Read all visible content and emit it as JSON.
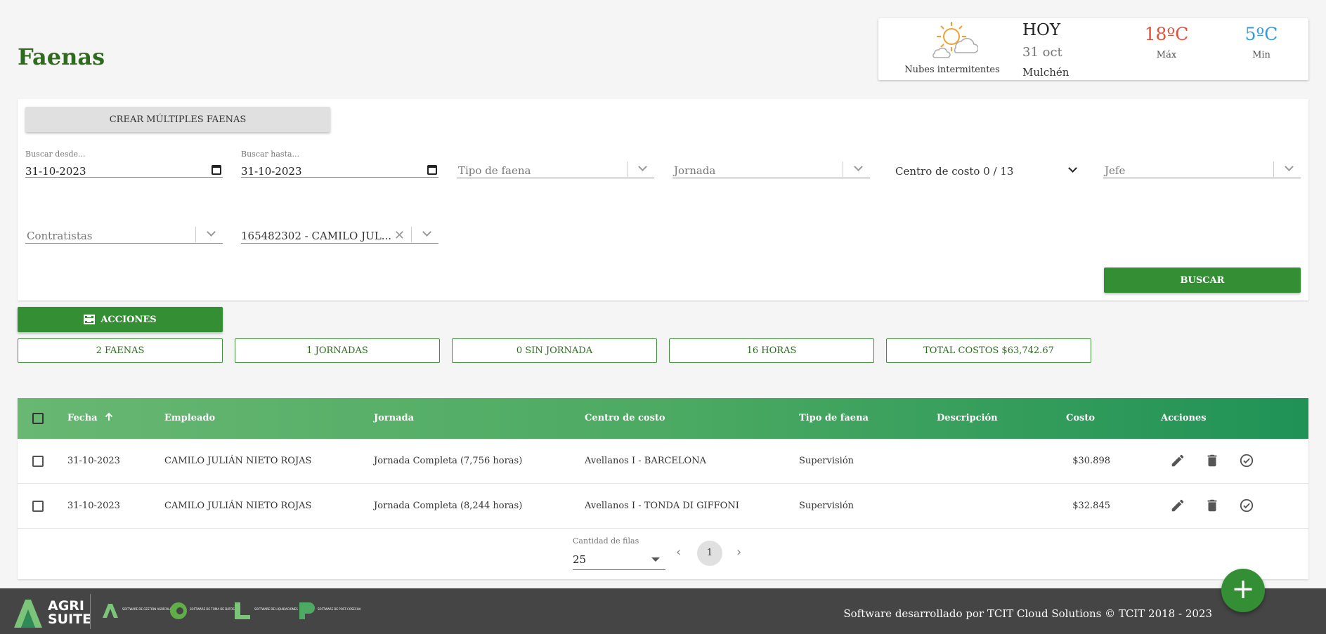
{
  "page": {
    "title": "Faenas"
  },
  "weather": {
    "description": "Nubes intermitentes",
    "day_label": "HOY",
    "date": "31 oct",
    "city": "Mulchén",
    "max_temp": "18ºC",
    "max_label": "Máx",
    "min_temp": "5ºC",
    "min_label": "Min",
    "icon": "partly-cloudy-icon"
  },
  "filters": {
    "create_multiple_label": "CREAR MÚLTIPLES FAENAS",
    "desde": {
      "label": "Buscar desde...",
      "value": "31-10-2023"
    },
    "hasta": {
      "label": "Buscar hasta...",
      "value": "31-10-2023"
    },
    "tipo_faena_placeholder": "Tipo de faena",
    "jornada_placeholder": "Jornada",
    "centro_costo_value": "Centro de costo 0 / 13",
    "jefe_placeholder": "Jefe",
    "contratistas_placeholder": "Contratistas",
    "empleado_value": "165482302 - CAMILO JUL...",
    "search_label": "BUSCAR"
  },
  "actions_label": "ACCIONES",
  "stats": [
    "2 FAENAS",
    "1 JORNADAS",
    "0 SIN JORNADA",
    "16 HORAS",
    "TOTAL COSTOS $63,742.67"
  ],
  "table": {
    "headers": {
      "fecha": "Fecha",
      "empleado": "Empleado",
      "jornada": "Jornada",
      "centro": "Centro de costo",
      "tipo": "Tipo de faena",
      "descripcion": "Descripción",
      "costo": "Costo",
      "acciones": "Acciones"
    },
    "rows": [
      {
        "fecha": "31-10-2023",
        "empleado": "CAMILO JULIÁN NIETO ROJAS",
        "jornada": "Jornada Completa (7,756 horas)",
        "centro": "Avellanos I - BARCELONA",
        "tipo": "Supervisión",
        "descripcion": "",
        "costo": "$30.898"
      },
      {
        "fecha": "31-10-2023",
        "empleado": "CAMILO JULIÁN NIETO ROJAS",
        "jornada": "Jornada Completa (8,244 horas)",
        "centro": "Avellanos I - TONDA DI GIFFONI",
        "tipo": "Supervisión",
        "descripcion": "",
        "costo": "$32.845"
      }
    ]
  },
  "pagination": {
    "rows_label": "Cantidad de filas",
    "rows_value": "25",
    "page": "1"
  },
  "footer": {
    "copyright": "Software desarrollado por TCIT Cloud Solutions © TCIT 2018 - 2023",
    "brand": "AGRI SUITE",
    "products": [
      "SOFTWARE DE GESTIÓN AGRÍCOLA",
      "SOFTWARE DE TOMA DE DATOS",
      "SOFTWARE DE LIQUIDACIONES",
      "SOFTWARE DE POST-COSECHA"
    ]
  },
  "colors": {
    "primary_green": "#348e34",
    "max_temp": "#e0503a",
    "min_temp": "#2d9be6",
    "footer": "#454545"
  }
}
